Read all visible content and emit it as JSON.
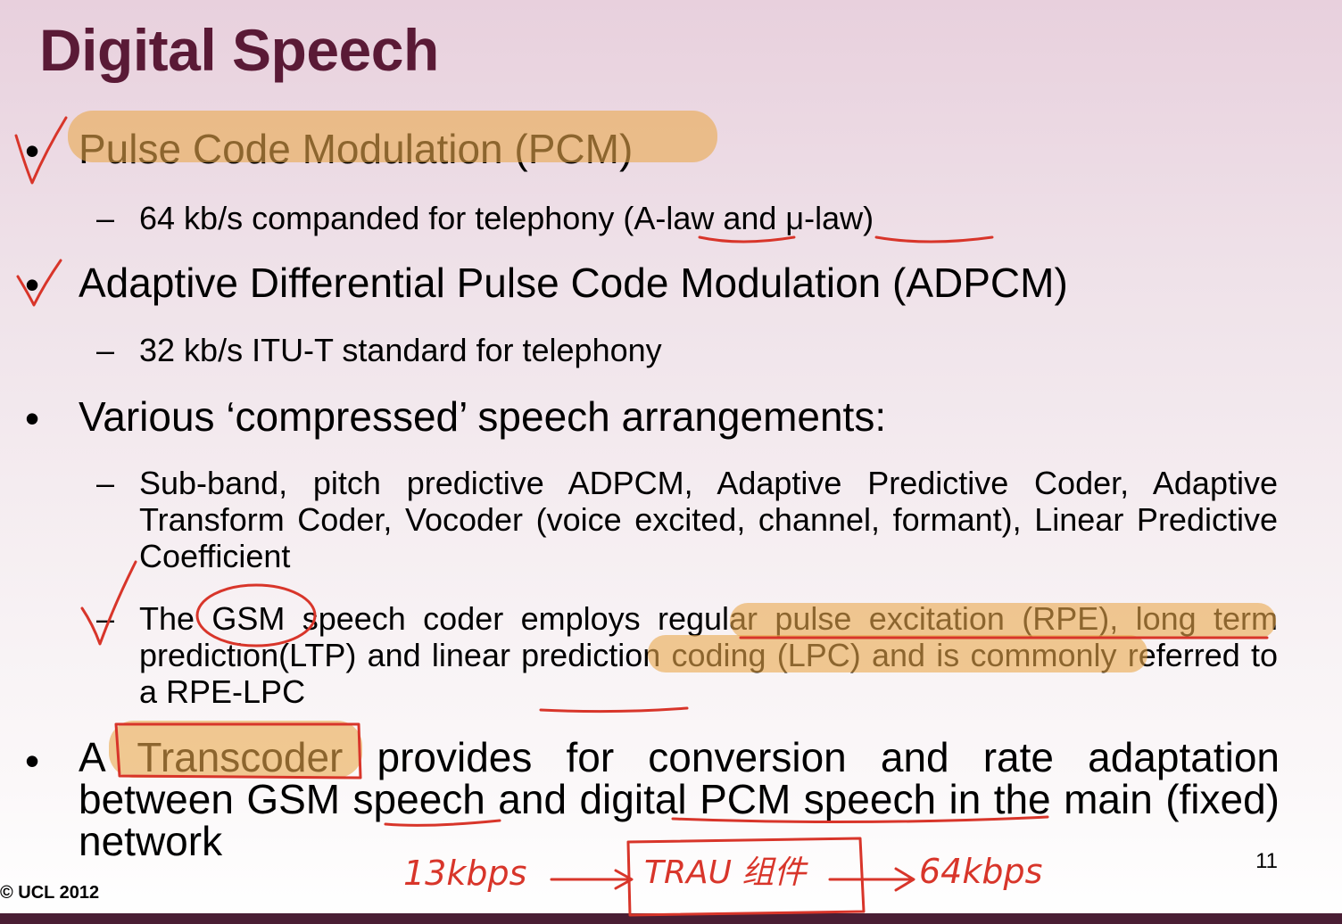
{
  "slide": {
    "title": "Digital Speech",
    "page_number": "11",
    "copyright": "© UCL 2012"
  },
  "bullets": {
    "b1": "Pulse Code Modulation (PCM)",
    "b1_sub": "64 kb/s companded for telephony (A-law and μ-law)",
    "b2": "Adaptive Differential Pulse Code Modulation (ADPCM)",
    "b2_sub": "32 kb/s ITU-T standard for telephony",
    "b3": "Various ‘compressed’ speech arrangements:",
    "b3_sub1": "Sub-band, pitch predictive ADPCM, Adaptive Predictive Coder, Adaptive Transform Coder, Vocoder (voice excited, channel, formant), Linear Predictive Coefficient",
    "b3_sub2": "The GSM speech coder employs regular pulse excitation (RPE), long term prediction(LTP) and linear prediction coding (LPC) and is commonly referred to a RPE-LPC",
    "b4": "A Transcoder provides for conversion and rate adaptation between GSM speech and digital PCM speech in the main (fixed) network"
  },
  "handwriting": {
    "left": "13kbps",
    "box": "TRAU 组件",
    "right": "64kbps"
  },
  "colors": {
    "title": "#5a1a36",
    "highlight": "#e9a94c",
    "pen": "#d8352a"
  }
}
